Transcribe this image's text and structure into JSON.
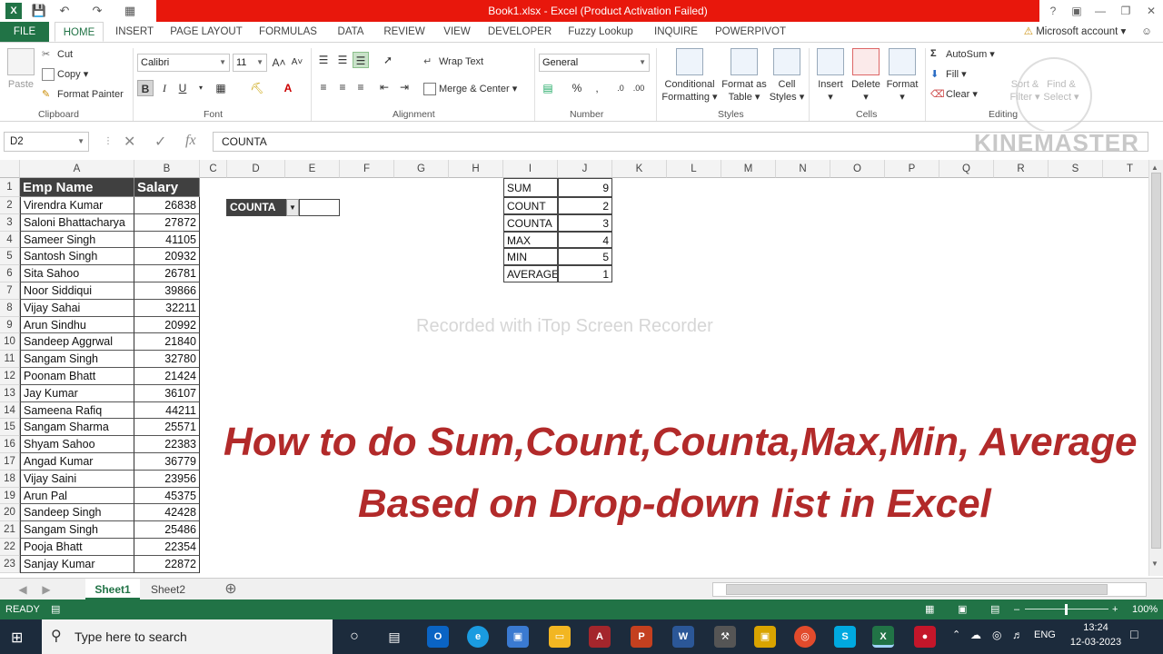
{
  "window": {
    "title": "Book1.xlsx - Excel (Product Activation Failed)",
    "help": "?",
    "account": "Microsoft account"
  },
  "menu_tabs": [
    "FILE",
    "HOME",
    "INSERT",
    "PAGE LAYOUT",
    "FORMULAS",
    "DATA",
    "REVIEW",
    "VIEW",
    "DEVELOPER",
    "Fuzzy Lookup",
    "INQUIRE",
    "POWERPIVOT"
  ],
  "ribbon": {
    "clipboard": {
      "paste": "Paste",
      "cut": "Cut",
      "copy": "Copy",
      "format_painter": "Format Painter",
      "label": "Clipboard"
    },
    "font": {
      "name": "Calibri",
      "size": "11",
      "bold": "B",
      "italic": "I",
      "underline": "U",
      "label": "Font"
    },
    "alignment": {
      "wrap": "Wrap Text",
      "merge": "Merge & Center",
      "label": "Alignment"
    },
    "number": {
      "format": "General",
      "label": "Number"
    },
    "styles": {
      "conditional": "Conditional",
      "conditional2": "Formatting",
      "format_table": "Format as",
      "format_table2": "Table",
      "cell_styles": "Cell",
      "cell_styles2": "Styles",
      "label": "Styles"
    },
    "cells": {
      "insert": "Insert",
      "delete": "Delete",
      "format": "Format",
      "label": "Cells"
    },
    "editing": {
      "autosum": "AutoSum",
      "fill": "Fill",
      "clear": "Clear",
      "sort": "Sort &",
      "sort2": "Filter",
      "find": "Find &",
      "find2": "Select",
      "label": "Editing"
    }
  },
  "formula_bar": {
    "name_box": "D2",
    "formula": "COUNTA"
  },
  "columns": [
    "A",
    "B",
    "C",
    "D",
    "E",
    "F",
    "G",
    "H",
    "I",
    "J",
    "K",
    "L",
    "M",
    "N",
    "O",
    "P",
    "Q",
    "R",
    "S",
    "T"
  ],
  "table": {
    "headers": [
      "Emp Name",
      "Salary"
    ],
    "rows": [
      [
        "Virendra Kumar",
        "26838"
      ],
      [
        "Saloni Bhattacharya",
        "27872"
      ],
      [
        "Sameer Singh",
        "41105"
      ],
      [
        "Santosh Singh",
        "20932"
      ],
      [
        "Sita Sahoo",
        "26781"
      ],
      [
        "Noor Siddiqui",
        "39866"
      ],
      [
        "Vijay Sahai",
        "32211"
      ],
      [
        "Arun Sindhu",
        "20992"
      ],
      [
        "Sandeep Aggrwal",
        "21840"
      ],
      [
        "Sangam Singh",
        "32780"
      ],
      [
        "Poonam Bhatt",
        "21424"
      ],
      [
        "Jay Kumar",
        "36107"
      ],
      [
        "Sameena Rafiq",
        "44211"
      ],
      [
        "Sangam Sharma",
        "25571"
      ],
      [
        "Shyam Sahoo",
        "22383"
      ],
      [
        "Angad Kumar",
        "36779"
      ],
      [
        "Vijay Saini",
        "23956"
      ],
      [
        "Arun Pal",
        "45375"
      ],
      [
        "Sandeep Singh",
        "42428"
      ],
      [
        "Sangam Singh",
        "25486"
      ],
      [
        "Pooja Bhatt",
        "22354"
      ],
      [
        "Sanjay Kumar",
        "22872"
      ]
    ]
  },
  "dropdown_cell": {
    "value": "COUNTA"
  },
  "lookup": [
    [
      "SUM",
      "9"
    ],
    [
      "COUNT",
      "2"
    ],
    [
      "COUNTA",
      "3"
    ],
    [
      "MAX",
      "4"
    ],
    [
      "MIN",
      "5"
    ],
    [
      "AVERAGE",
      "1"
    ]
  ],
  "sheets": [
    "Sheet1",
    "Sheet2"
  ],
  "status": {
    "ready": "READY",
    "zoom": "100%"
  },
  "taskbar": {
    "search": "Type here to search",
    "time": "13:24",
    "date": "12-03-2023",
    "lang": "ENG"
  },
  "overlay": {
    "line1": "How to do Sum,Count,Counta,Max,Min, Average",
    "line2": "Based on Drop-down list in Excel",
    "recorder": "Recorded with iTop Screen Recorder",
    "kinemaster": "KINEMASTER"
  }
}
